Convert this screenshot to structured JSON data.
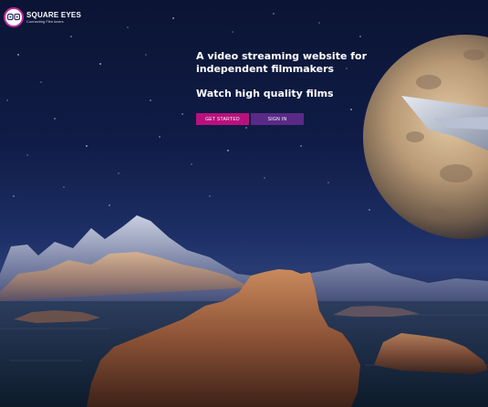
{
  "brand": {
    "name": "SQUARE EYES",
    "tagline": "Connecting Film lovers"
  },
  "hero": {
    "headline": "A video streaming website for independent filmmakers",
    "subheadline": "Watch high quality films"
  },
  "actions": {
    "get_started_label": "GET STARTED",
    "sign_in_label": "SIGN IN"
  },
  "colors": {
    "accent_primary": "#b8117e",
    "accent_secondary": "#5a2a86",
    "brand_ring": "#c02a9e"
  }
}
